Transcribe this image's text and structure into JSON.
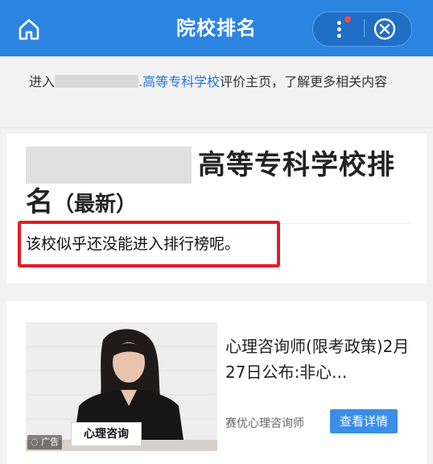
{
  "header": {
    "title": "院校排名",
    "home_icon": "home-icon",
    "more_icon": "more-vertical-icon",
    "close_icon": "close-circle-icon",
    "badge_color": "#f04b4b",
    "brand_color": "#2b84e0"
  },
  "intro": {
    "prefix": "进入",
    "link_text": ".高等专科学校",
    "suffix": "评价主页，了解更多相关内容"
  },
  "ranking": {
    "title_part1": "高等专科学校排",
    "title_part2": "名",
    "title_latest": "（最新）",
    "notice": "该校似乎还没能进入排行榜呢。",
    "notice_border_color": "#e51b22"
  },
  "ad": {
    "image_sign": "心理咨询",
    "badge": "广告",
    "title": "心理咨询师(限考政策)2月27日公布:非心...",
    "source": "赛优心理咨询师",
    "button": "查看详情"
  }
}
